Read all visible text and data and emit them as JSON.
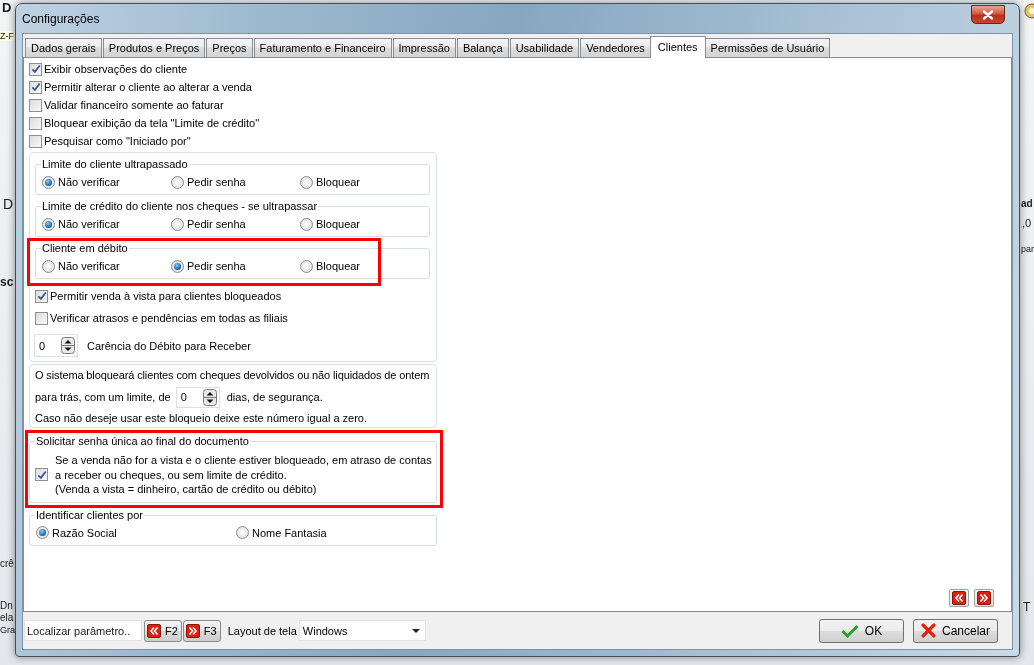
{
  "background_window": {
    "left_edge_texts": [
      "D",
      "Z-F",
      "D",
      "sc",
      "crê",
      "Dn",
      "ela",
      "Gra"
    ],
    "right_edge_texts": [
      "ad",
      ",0",
      "par",
      "T"
    ]
  },
  "dialog": {
    "title": "Configurações",
    "tabs": [
      {
        "label": "Dados gerais",
        "selected": false
      },
      {
        "label": "Produtos e Preços",
        "selected": false
      },
      {
        "label": "Preços",
        "selected": false
      },
      {
        "label": "Faturamento e Financeiro",
        "selected": false
      },
      {
        "label": "Impressão",
        "selected": false
      },
      {
        "label": "Balança",
        "selected": false
      },
      {
        "label": "Usabilidade",
        "selected": false
      },
      {
        "label": "Vendedores",
        "selected": false
      },
      {
        "label": "Clientes",
        "selected": true
      },
      {
        "label": "Permissões de Usuário",
        "selected": false
      }
    ],
    "checkboxes": [
      {
        "label": "Exibir observações do cliente",
        "checked": true
      },
      {
        "label": "Permitir alterar o cliente ao alterar a venda",
        "checked": true
      },
      {
        "label": "Validar financeiro somente ao faturar",
        "checked": false
      },
      {
        "label": "Bloquear exibição da tela \"Limite de crédito\"",
        "checked": false
      },
      {
        "label": "Pesquisar como \"Iniciado por\"",
        "checked": false
      }
    ],
    "credit_panel": {
      "radio_groups": [
        {
          "title": "Limite do cliente ultrapassado",
          "highlighted": false,
          "options": [
            {
              "label": "Não verificar",
              "selected": true
            },
            {
              "label": "Pedir senha",
              "selected": false
            },
            {
              "label": "Bloquear",
              "selected": false
            }
          ]
        },
        {
          "title": "Limite de crédito do cliente nos cheques - se ultrapassar",
          "highlighted": false,
          "options": [
            {
              "label": "Não verificar",
              "selected": true
            },
            {
              "label": "Pedir senha",
              "selected": false
            },
            {
              "label": "Bloquear",
              "selected": false
            }
          ]
        },
        {
          "title": "Cliente em débito",
          "highlighted": true,
          "options": [
            {
              "label": "Não verificar",
              "selected": false
            },
            {
              "label": "Pedir senha",
              "selected": true
            },
            {
              "label": "Bloquear",
              "selected": false
            }
          ]
        }
      ],
      "checkboxes": [
        {
          "label": "Permitir venda à vista para clientes bloqueados",
          "checked": true
        },
        {
          "label": "Verificar atrasos e pendências em todas as filiais",
          "checked": false
        }
      ],
      "grace_period": {
        "value": "0",
        "label": "Carência do Débito para Receber"
      }
    },
    "cheque_block_panel": {
      "first_line": "O sistema bloqueará clientes com cheques devolvidos ou não liquidados de ontem",
      "limit_prefix": "para trás, com um limite, de",
      "limit_value": "0",
      "limit_suffix": "dias, de segurança.",
      "hint": "Caso não deseje usar este bloqueio deixe este número igual a zero."
    },
    "single_password_group": {
      "title": "Solicitar senha única ao final do documento",
      "highlighted": true,
      "checked": true,
      "description_lines": [
        "Se a venda não for a vista e o cliente estiver bloqueado, em atraso de contas",
        "a receber ou cheques, ou sem limite de crédito.",
        "(Venda a vista = dinheiro, cartão de crédito ou débito)"
      ]
    },
    "identify_clients_group": {
      "title": "Identificar clientes por",
      "options": [
        {
          "label": "Razão Social",
          "selected": true
        },
        {
          "label": "Nome Fantasia",
          "selected": false
        }
      ]
    }
  },
  "footer": {
    "search": {
      "placeholder": "Localizar parâmetro.."
    },
    "shortcut_buttons": [
      {
        "kind": "previous",
        "label": "F2"
      },
      {
        "kind": "next",
        "label": "F3"
      }
    ],
    "layout": {
      "label": "Layout de tela",
      "value": "Windows"
    },
    "buttons": [
      {
        "kind": "ok",
        "label": "OK"
      },
      {
        "kind": "cancel",
        "label": "Cancelar"
      }
    ]
  }
}
